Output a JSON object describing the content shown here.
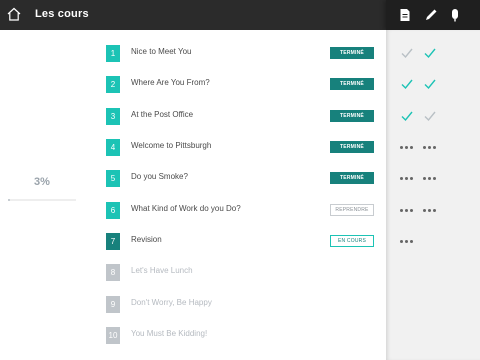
{
  "header": {
    "title": "Les cours",
    "home_icon": "home-icon",
    "tool_icons": [
      "document-icon",
      "pen-icon",
      "microphone-icon"
    ]
  },
  "progress": {
    "percent_label": "3%",
    "fraction": 0.03
  },
  "lessons": [
    {
      "number": "1",
      "title": "Nice to Meet You",
      "status": "TERMINÉ",
      "status_type": "done",
      "num_style": "teal",
      "mark_a": "check-light",
      "mark_b": "check-teal"
    },
    {
      "number": "2",
      "title": "Where Are You From?",
      "status": "TERMINÉ",
      "status_type": "done",
      "num_style": "teal",
      "mark_a": "check-teal",
      "mark_b": "check-teal"
    },
    {
      "number": "3",
      "title": "At the Post Office",
      "status": "TERMINÉ",
      "status_type": "done",
      "num_style": "teal",
      "mark_a": "check-teal",
      "mark_b": "check-light"
    },
    {
      "number": "4",
      "title": "Welcome to Pittsburgh",
      "status": "TERMINÉ",
      "status_type": "done",
      "num_style": "teal",
      "mark_a": "dots",
      "mark_b": "dots"
    },
    {
      "number": "5",
      "title": "Do you Smoke?",
      "status": "TERMINÉ",
      "status_type": "done",
      "num_style": "teal",
      "mark_a": "dots",
      "mark_b": "dots"
    },
    {
      "number": "6",
      "title": "What Kind of Work do you Do?",
      "status": "REPRENDRE",
      "status_type": "resume",
      "num_style": "teal",
      "mark_a": "dots",
      "mark_b": "dots"
    },
    {
      "number": "7",
      "title": "Revision",
      "status": "EN COURS",
      "status_type": "current",
      "num_style": "dark",
      "mark_a": "dots",
      "mark_b": ""
    },
    {
      "number": "8",
      "title": "Let's Have Lunch",
      "status": "",
      "status_type": "",
      "num_style": "grey",
      "mark_a": "",
      "mark_b": ""
    },
    {
      "number": "9",
      "title": "Don't Worry, Be Happy",
      "status": "",
      "status_type": "",
      "num_style": "grey",
      "mark_a": "",
      "mark_b": ""
    },
    {
      "number": "10",
      "title": "You Must Be Kidding!",
      "status": "",
      "status_type": "",
      "num_style": "grey",
      "mark_a": "",
      "mark_b": ""
    }
  ],
  "colors": {
    "teal": "#1cc3b5",
    "dark_teal": "#17817c",
    "grey": "#c0c5ca",
    "topbar": "#2b2b2b"
  }
}
